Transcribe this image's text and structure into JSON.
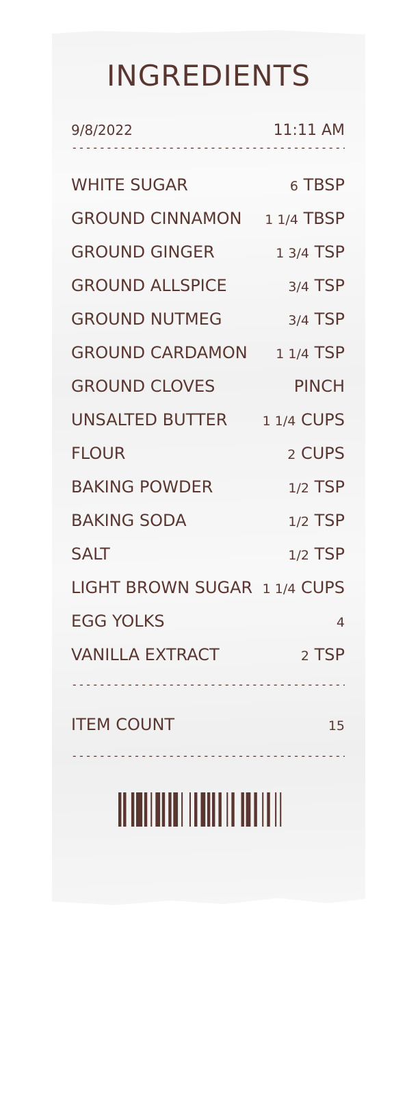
{
  "receipt": {
    "title": "INGREDIENTS",
    "date": "9/8/2022",
    "time": "11:11 AM",
    "items": [
      {
        "name": "WHITE SUGAR",
        "amount": "6",
        "unit": "TBSP"
      },
      {
        "name": "GROUND CINNAMON",
        "amount": "1 1/4",
        "unit": "TBSP"
      },
      {
        "name": "GROUND GINGER",
        "amount": "1 3/4",
        "unit": "TSP"
      },
      {
        "name": "GROUND ALLSPICE",
        "amount": "3/4",
        "unit": "TSP"
      },
      {
        "name": "GROUND NUTMEG",
        "amount": "3/4",
        "unit": "TSP"
      },
      {
        "name": "GROUND CARDAMON",
        "amount": "1 1/4",
        "unit": "TSP"
      },
      {
        "name": "GROUND CLOVES",
        "amount": "",
        "unit": "PINCH"
      },
      {
        "name": "UNSALTED BUTTER",
        "amount": "1 1/4",
        "unit": "CUPS"
      },
      {
        "name": "FLOUR",
        "amount": "2",
        "unit": "CUPS"
      },
      {
        "name": "BAKING POWDER",
        "amount": "1/2",
        "unit": "TSP"
      },
      {
        "name": "BAKING SODA",
        "amount": "1/2",
        "unit": "TSP"
      },
      {
        "name": "SALT",
        "amount": "1/2",
        "unit": "TSP"
      },
      {
        "name": "LIGHT BROWN SUGAR",
        "amount": "1 1/4",
        "unit": "CUPS"
      },
      {
        "name": "EGG YOLKS",
        "amount": "4",
        "unit": ""
      },
      {
        "name": "VANILLA EXTRACT",
        "amount": "2",
        "unit": "TSP"
      }
    ],
    "item_count_label": "ITEM COUNT",
    "item_count_value": "15",
    "separator": "------------------------------------------------------------",
    "ink_color": "#5a3630",
    "barcode_pattern": "1012103011012011102103011120101112011310211201120103"
  }
}
